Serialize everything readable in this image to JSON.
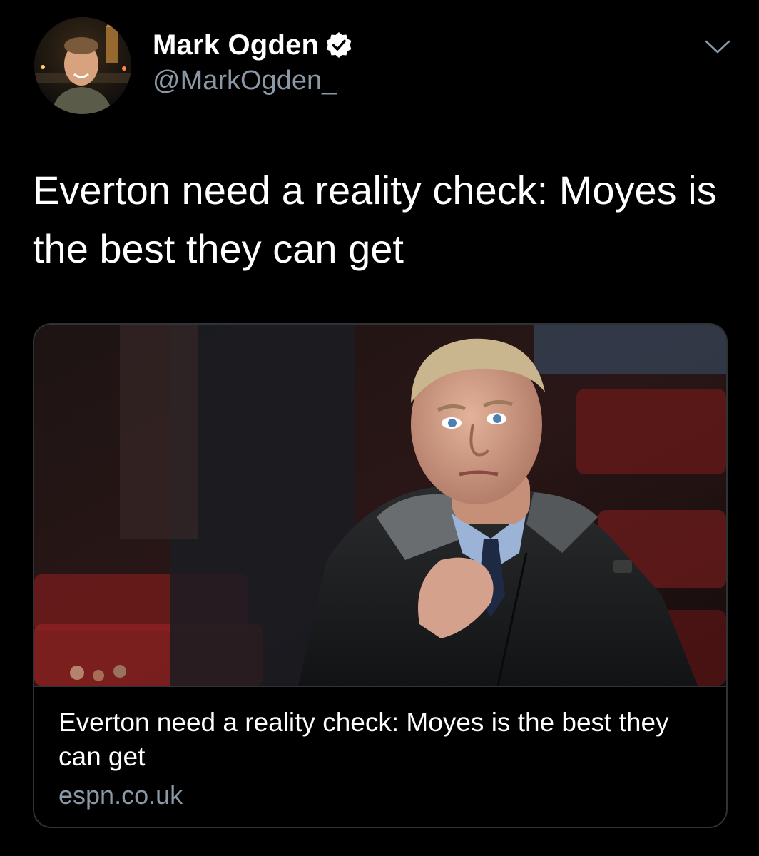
{
  "tweet": {
    "author": {
      "name": "Mark Ogden",
      "handle": "@MarkOgden_",
      "verified": true,
      "avatar_icon": "profile-photo"
    },
    "menu_icon": "chevron-down-icon",
    "text": "Everton need a reality check: Moyes is the best they can get",
    "card": {
      "title": "Everton need a reality check: Moyes is the best they can get",
      "domain": "espn.co.uk",
      "image_icon": "article-photo"
    }
  },
  "colors": {
    "background": "#000000",
    "text_primary": "#ffffff",
    "text_secondary": "#8b98a5",
    "border": "#2f3336"
  }
}
